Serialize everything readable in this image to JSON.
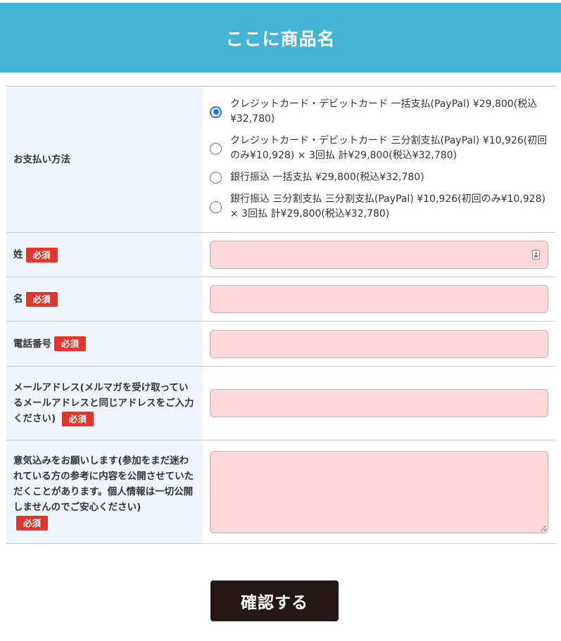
{
  "header": {
    "title": "ここに商品名"
  },
  "form": {
    "required_label": "必須",
    "payment": {
      "label": "お支払い方法",
      "options": [
        {
          "text": "クレジットカード・デビットカード 一括支払(PayPal) ¥29,800(税込¥32,780)",
          "checked": true
        },
        {
          "text": "クレジットカード・デビットカード 三分割支払(PayPal) ¥10,926(初回のみ¥10,928) × 3回払 計¥29,800(税込¥32,780)",
          "checked": false
        },
        {
          "text": "銀行振込 一括支払 ¥29,800(税込¥32,780)",
          "checked": false
        },
        {
          "text": "銀行振込 三分割支払 三分割支払(PayPal) ¥10,926(初回のみ¥10,928) × 3回払 計¥29,800(税込¥32,780)",
          "checked": false
        }
      ]
    },
    "last_name": {
      "label": "姓",
      "value": ""
    },
    "first_name": {
      "label": "名",
      "value": ""
    },
    "phone": {
      "label": "電話番号",
      "value": ""
    },
    "email": {
      "label": "メールアドレス(メルマガを受け取っているメールアドレスと同じアドレスをご入力ください)",
      "value": ""
    },
    "message": {
      "label": "意気込みをお願いします(参加をまだ迷われている方の参考に内容を公開させていただくことがあります。個人情報は一切公開しませんのでご安心ください)",
      "value": ""
    }
  },
  "submit": {
    "label": "確認する"
  },
  "colors": {
    "header_bg": "#44b4d6",
    "label_bg": "#eef5fc",
    "input_bg": "#fdd8d8",
    "required_badge": "#e8332a",
    "submit_bg": "#231815",
    "radio_checked": "#1a73e8"
  }
}
